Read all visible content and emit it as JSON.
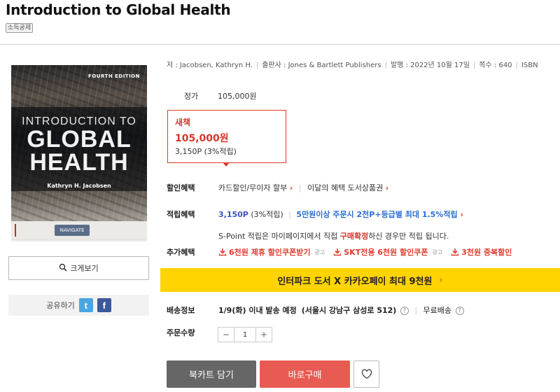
{
  "product": {
    "title": "Introduction to Global Health",
    "tag": "소득공제"
  },
  "cover": {
    "edition": "FOURTH EDITION",
    "line1": "INTRODUCTION TO",
    "line2": "GLOBAL",
    "line3": "HEALTH",
    "author": "Kathryn H. Jacobsen",
    "badge": "NAVIGATE eBOOK"
  },
  "left_panel": {
    "zoom_label": "크게보기",
    "share_label": "공유하기",
    "twitter_icon": "t",
    "facebook_icon": "f"
  },
  "meta": {
    "author": "저 : Jacobsen, Kathryn H.",
    "publisher": "출판사 : Jones & Bartlett Publishers",
    "date": "발행 : 2022년 10월 17일",
    "pages": "쪽수 : 640",
    "isbn": "ISBN"
  },
  "price": {
    "label": "정가",
    "value": "105,000원",
    "new_label": "새책",
    "new_price": "105,000원",
    "new_points": "3,150P (3%적립)"
  },
  "benefits": {
    "discount_label": "할인혜택",
    "discount_text1": "카드할인/무이자 할부",
    "discount_text2": "이달의 혜택 도서상품권",
    "points_label": "적립혜택",
    "points_value": "3,150P",
    "points_rate": "(3%적립)",
    "points_extra": "5만원이상 주문시 2천P+등급별 최대 1.5%적립",
    "spoint_pre": "S-Point 적립은 마이페이지에서 직접 ",
    "spoint_red": "구매확정",
    "spoint_post": "하신 경우만 적립 됩니다.",
    "extra_label": "추가혜택",
    "coupons": [
      "6천원 제휴 할인쿠폰받기",
      "SKT전용 6천원 할인쿠폰",
      "3천원 중복할인"
    ],
    "ad_label": "광고"
  },
  "banner": {
    "text": "인터파크 도서 X 카카오페이 최대 9천원",
    "color": "#ffd400"
  },
  "shipping": {
    "label": "배송정보",
    "text": "1/9(화) 이내 발송 예정",
    "address": "(서울시 강남구 삼성로 512)",
    "free": "무료배송"
  },
  "quantity": {
    "label": "주문수량",
    "value": "1",
    "minus": "−",
    "plus": "+"
  },
  "actions": {
    "cart": "북카트 담기",
    "buy": "바로구매",
    "wish_icon": "heart-icon"
  },
  "colors": {
    "accent_red": "#e03a2f",
    "point_blue": "#3a52c5",
    "buy_button": "#e85b52",
    "cart_button": "#666666"
  }
}
